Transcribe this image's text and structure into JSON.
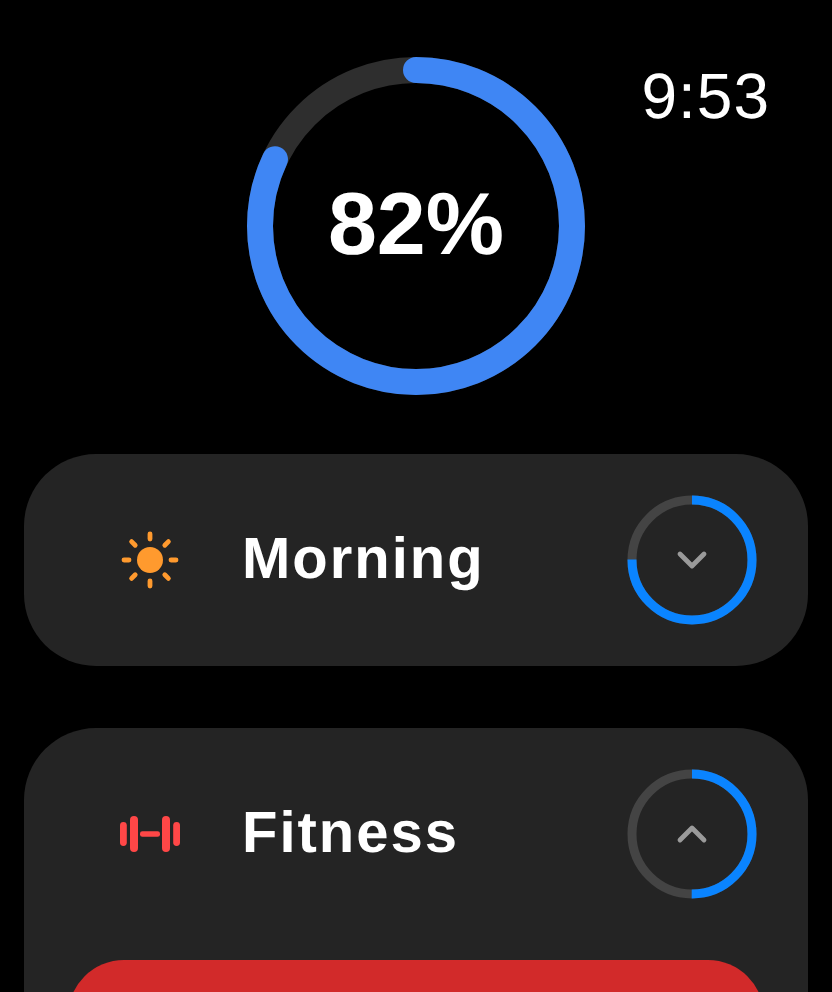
{
  "time": "9:53",
  "progress": {
    "level": 0.82,
    "label": "82%"
  },
  "routines": [
    {
      "kind": "sun",
      "name": "Morning",
      "expanded": false
    },
    {
      "kind": "dumbbell",
      "name": "Fitness",
      "expanded": true
    }
  ]
}
